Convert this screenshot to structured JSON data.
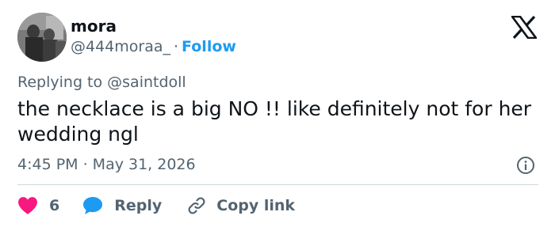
{
  "author": {
    "name": "mora",
    "handle": "@444moraa_",
    "separator": "·",
    "follow_label": "Follow"
  },
  "reply_context": {
    "prefix": "Replying to ",
    "mention": "@saintdoll"
  },
  "tweet": {
    "text": "the necklace is a big NO !! like definitely not for her wedding ngl",
    "timestamp": "4:45 PM · May 31, 2026"
  },
  "actions": {
    "like_count": "6",
    "reply_label": "Reply",
    "copy_link_label": "Copy link"
  },
  "icons": {
    "platform": "x-logo-icon",
    "info": "info-icon",
    "like": "heart-icon",
    "reply": "speech-bubble-icon",
    "copy": "link-icon"
  },
  "colors": {
    "text": "#0f1419",
    "secondary": "#536471",
    "accent": "#1d9bf0",
    "like": "#f91880",
    "divider": "#cfd9de"
  }
}
